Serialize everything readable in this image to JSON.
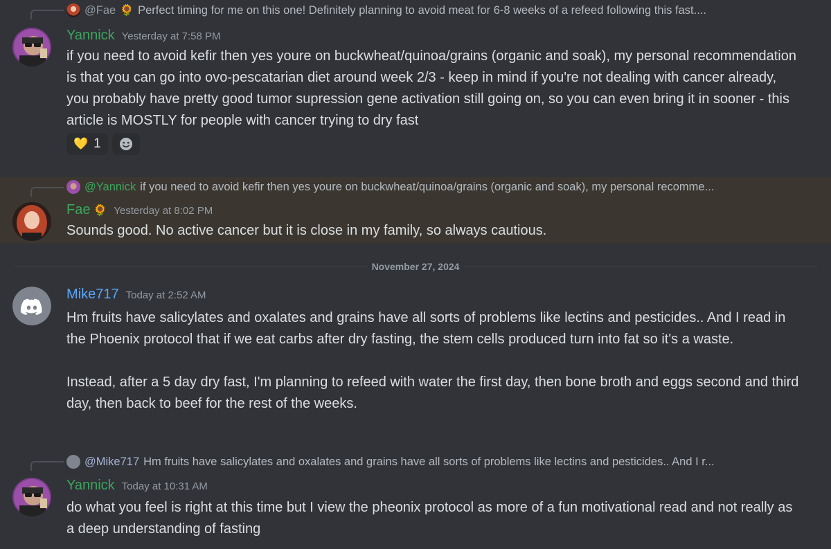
{
  "messages": [
    {
      "reply_to": {
        "mention": "@Fae",
        "emoji": "🌻",
        "text": "Perfect timing for me on this one!  Definitely planning to avoid meat for 6-8 weeks of a refeed following this fast...."
      },
      "author": "Yannick",
      "author_color": "#3ba55d",
      "timestamp": "Yesterday at 7:58 PM",
      "content": "if you need to avoid kefir then yes youre on buckwheat/quinoa/grains (organic and soak), my personal recommendation is that you can go into ovo-pescatarian diet around week 2/3 - keep in mind if you're not dealing with cancer already, you probably have pretty good tumor supression gene activation still going on, so you can even bring it in sooner - this article is MOSTLY for people with cancer trying to dry fast",
      "reactions": [
        {
          "emoji": "💛",
          "count": "1"
        }
      ]
    },
    {
      "reply_to": {
        "mention": "@Yannick",
        "text": "if you need to avoid kefir then yes youre on buckwheat/quinoa/grains (organic and soak), my personal recomme..."
      },
      "author": "Fae",
      "author_emoji": "🌻",
      "timestamp": "Yesterday at 8:02 PM",
      "content": "Sounds good. No active cancer but it is close in my family, so always cautious."
    },
    {
      "author": "Mike717",
      "author_color": "#58a6ff",
      "timestamp": "Today at 2:52 AM",
      "content_p1": "Hm fruits have salicylates and oxalates and grains have all sorts of problems like lectins and pesticides.. And I read in the Phoenix protocol that if we eat carbs after dry fasting, the stem cells produced turn into fat so it's a waste.",
      "content_p2": "Instead, after a 5 day dry fast, I'm planning to refeed with water the first day, then bone broth and eggs second and third day, then back to beef for the rest of the weeks."
    },
    {
      "reply_to": {
        "mention": "@Mike717",
        "text": "Hm fruits have salicylates and oxalates and grains have all sorts of problems like lectins and pesticides.. And I r..."
      },
      "author": "Yannick",
      "author_color": "#3ba55d",
      "timestamp": "Today at 10:31 AM",
      "content": "do what you feel is right at this time but I view the pheonix protocol as more of a fun motivational read and not really as a deep understanding of fasting"
    }
  ],
  "date_divider": "November 27, 2024",
  "colors": {
    "background": "#313338",
    "highlight": "#3b3730",
    "yannick_green": "#3ba55d",
    "mike_blue": "#58a6ff"
  }
}
